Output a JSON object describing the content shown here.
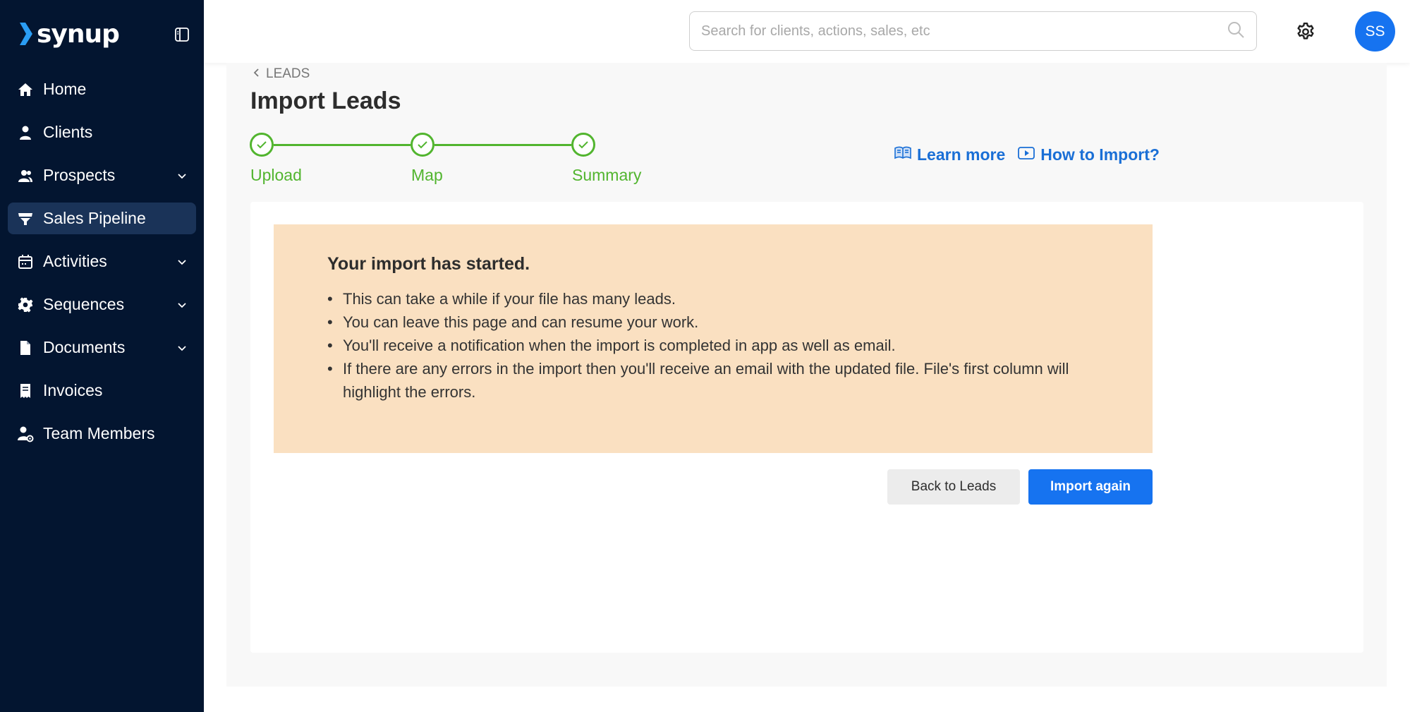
{
  "brand": {
    "name": "synup"
  },
  "sidebar": {
    "items": [
      {
        "label": "Home",
        "icon": "home-icon",
        "expandable": false,
        "active": false
      },
      {
        "label": "Clients",
        "icon": "user-icon",
        "expandable": false,
        "active": false
      },
      {
        "label": "Prospects",
        "icon": "users-icon",
        "expandable": true,
        "active": false
      },
      {
        "label": "Sales Pipeline",
        "icon": "funnel-icon",
        "expandable": false,
        "active": true
      },
      {
        "label": "Activities",
        "icon": "calendar-icon",
        "expandable": true,
        "active": false
      },
      {
        "label": "Sequences",
        "icon": "cog-icon",
        "expandable": true,
        "active": false
      },
      {
        "label": "Documents",
        "icon": "document-icon",
        "expandable": true,
        "active": false
      },
      {
        "label": "Invoices",
        "icon": "receipt-icon",
        "expandable": false,
        "active": false
      },
      {
        "label": "Team Members",
        "icon": "user-settings-icon",
        "expandable": false,
        "active": false
      }
    ]
  },
  "topbar": {
    "search_placeholder": "Search for clients, actions, sales, etc",
    "avatar_initials": "SS"
  },
  "breadcrumb": {
    "label": "LEADS"
  },
  "page": {
    "title": "Import Leads"
  },
  "stepper": {
    "steps": [
      {
        "label": "Upload",
        "status": "complete"
      },
      {
        "label": "Map",
        "status": "complete"
      },
      {
        "label": "Summary",
        "status": "complete"
      }
    ]
  },
  "help": {
    "learn_more": "Learn more",
    "how_to_import": "How to Import?"
  },
  "notice": {
    "title": "Your import has started.",
    "items": [
      "This can take a while if your file has many leads.",
      "You can leave this page and can resume your work.",
      "You'll receive a notification when the import is completed in app as well as email.",
      "If there are any errors in the import then you'll receive an email with the updated file. File's first column will highlight the errors."
    ]
  },
  "actions": {
    "back_label": "Back to Leads",
    "import_again_label": "Import again"
  },
  "colors": {
    "sidebar_bg": "#031530",
    "sidebar_active": "#1a3358",
    "accent": "#1673f0",
    "success": "#52b52f",
    "notice_bg": "#fae0c1",
    "link": "#1a6fd6"
  }
}
